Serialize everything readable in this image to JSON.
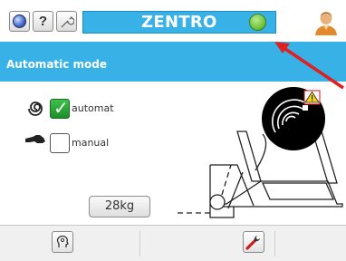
{
  "topbar": {
    "title": "ZENTRO",
    "help_label": "?",
    "status_color": "#6cc23a",
    "title_bg": "#38b1e6",
    "icons": [
      "globe-icon",
      "help-icon",
      "wrench-icon",
      "user-avatar"
    ]
  },
  "header": {
    "title": "Automatic mode"
  },
  "modes": [
    {
      "icon": "swirl-icon",
      "label": "automat",
      "checked": true
    },
    {
      "icon": "hand-icon",
      "label": "manual",
      "checked": false
    }
  ],
  "weight": {
    "value": "28kg"
  },
  "machine": {
    "sensor_icon": "rfid-sensor-icon",
    "warning_icon": "warning-icon"
  },
  "bottom_bar": {
    "icons": [
      "head-icon",
      "wrench-icon"
    ]
  },
  "accent_colors": {
    "annotation_arrow": "#e02020"
  }
}
